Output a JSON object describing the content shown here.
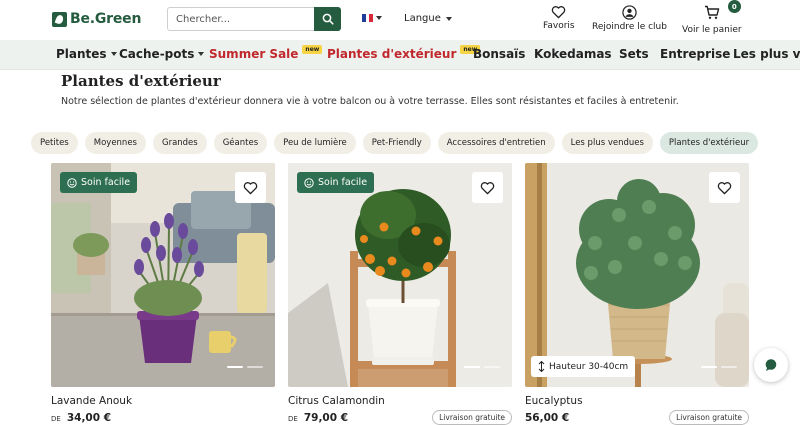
{
  "brand": {
    "name": "Be.Green"
  },
  "search": {
    "placeholder": "Chercher..."
  },
  "language": {
    "label": "Langue",
    "flag_colors": [
      "#1f3c9a",
      "#ffffff",
      "#d8283b"
    ]
  },
  "header_actions": {
    "favorites": "Favoris",
    "club": "Rejoindre le club",
    "cart": "Voir le panier",
    "cart_count": "0"
  },
  "nav": {
    "items": [
      {
        "label": "Plantes",
        "has_dropdown": true
      },
      {
        "label": "Cache-pots",
        "has_dropdown": true
      },
      {
        "label": "Summer Sale",
        "badge": "new",
        "highlight": true
      },
      {
        "label": "Plantes d'extérieur",
        "badge": "new",
        "highlight": true
      },
      {
        "label": "Bonsaïs"
      },
      {
        "label": "Kokedamas"
      },
      {
        "label": "Sets"
      },
      {
        "label": "Entreprise"
      },
      {
        "label": "Les plus vendues"
      }
    ]
  },
  "page": {
    "title": "Plantes d'extérieur",
    "description": "Notre sélection de plantes d'extérieur donnera vie à votre balcon ou à votre terrasse. Elles sont résistantes et faciles à entretenir."
  },
  "filters": [
    "Petites",
    "Moyennes",
    "Grandes",
    "Géantes",
    "Peu de lumière",
    "Pet-Friendly",
    "Accessoires d'entretien",
    "Les plus vendues",
    "Plantes d'extérieur"
  ],
  "active_filter": "Plantes d'extérieur",
  "products": [
    {
      "name": "Lavande Anouk",
      "price_prefix": "DE",
      "price": "34,00 €",
      "badge": "Soin facile",
      "free_shipping": "",
      "height_tag": ""
    },
    {
      "name": "Citrus Calamondin",
      "price_prefix": "DE",
      "price": "79,00 €",
      "badge": "Soin facile",
      "free_shipping": "Livraison gratuite",
      "height_tag": ""
    },
    {
      "name": "Eucalyptus",
      "price_prefix": "",
      "price": "56,00 €",
      "badge": "",
      "free_shipping": "Livraison gratuite",
      "height_tag": "Hauteur 30-40cm"
    }
  ],
  "colors": {
    "brand_green": "#255b3f",
    "sale_red": "#c0282d",
    "badge_yellow": "#f5d343"
  }
}
